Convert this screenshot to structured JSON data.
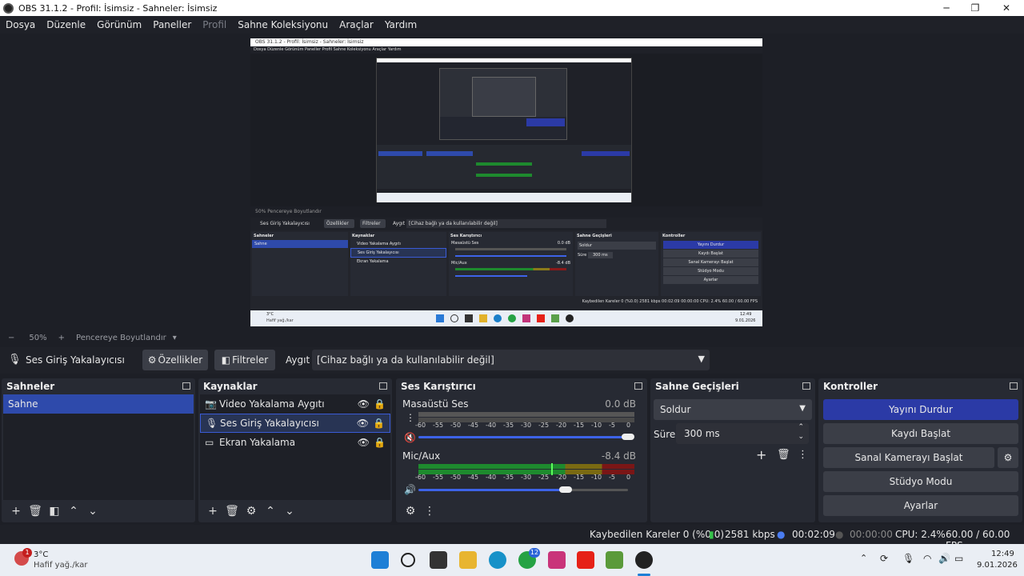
{
  "window": {
    "title": "OBS 31.1.2 - Profil: İsimsiz - Sahneler: İsimsiz",
    "minimize": "─",
    "maximize": "❐",
    "close": "✕"
  },
  "menu": {
    "items": [
      "Dosya",
      "Düzenle",
      "Görünüm",
      "Paneller",
      "Profil",
      "Sahne Koleksiyonu",
      "Araçlar",
      "Yardım"
    ],
    "disabled_index": 4
  },
  "preview_inner": {
    "title": "OBS 31.1.2 - Profil: İsimsiz - Sahneler: İsimsiz",
    "menu": "Dosya   Düzenle   Görünüm   Paneller   Profil   Sahne Koleksiyonu   Araçlar   Yardım",
    "zoom_text": "50%   Pencereye Boyutlandır",
    "source_name": "Ses Giriş Yakalayıcısı",
    "props": "Özellikler",
    "filters": "Filtreler",
    "device_label": "Aygıt",
    "device_value": "[Cihaz bağlı ya da kullanılabilir değil]",
    "scenes_title": "Sahneler",
    "scene": "Sahne",
    "sources_title": "Kaynaklar",
    "sources": [
      "Video Yakalama Aygıtı",
      "Ses Giriş Yakalayıcısı",
      "Ekran Yakalama"
    ],
    "mixer_title": "Ses Karıştırıcı",
    "mixer_ch1": "Masaüstü Ses",
    "mixer_ch1_db": "0.0 dB",
    "mixer_ch2": "Mic/Aux",
    "mixer_ch2_db": "-8.4 dB",
    "trans_title": "Sahne Geçişleri",
    "trans": "Soldur",
    "dur_label": "Süre",
    "dur": "300 ms",
    "ctl_title": "Kontroller",
    "ctl": [
      "Yayını Durdur",
      "Kaydı Başlat",
      "Sanal Kamerayı Başlat",
      "Stüdyo Modu",
      "Ayarlar"
    ],
    "status": "Kaybedilen Kareler 0 (%0.0)   2581 kbps   00:02:09   00:00:00   CPU: 2.4%   60.00 / 60.00 FPS",
    "weather": "3°C",
    "weather_desc": "Hafif yağ./kar",
    "time": "12:49",
    "date": "9.01.2026"
  },
  "zoom": {
    "minus": "−",
    "value": "50%",
    "plus": "+",
    "fit": "Pencereye Boyutlandır"
  },
  "source_toolbar": {
    "source_name": "Ses Giriş Yakalayıcısı",
    "properties": "Özellikler",
    "filters": "Filtreler",
    "device_label": "Aygıt",
    "device_value": "[Cihaz bağlı ya da kullanılabilir değil]"
  },
  "scenes": {
    "title": "Sahneler",
    "items": [
      "Sahne"
    ]
  },
  "sources": {
    "title": "Kaynaklar",
    "items": [
      "Video Yakalama Aygıtı",
      "Ses Giriş Yakalayıcısı",
      "Ekran Yakalama"
    ],
    "selected_index": 1
  },
  "mixer": {
    "title": "Ses Karıştırıcı",
    "scale": [
      "-60",
      "-55",
      "-50",
      "-45",
      "-40",
      "-35",
      "-30",
      "-25",
      "-20",
      "-15",
      "-10",
      "-5",
      "0"
    ],
    "channels": [
      {
        "name": "Masaüstü Ses",
        "db": "0.0 dB",
        "muted": true,
        "level": 0.0,
        "volume": 1.0
      },
      {
        "name": "Mic/Aux",
        "db": "-8.4 dB",
        "muted": false,
        "level": 0.62,
        "volume": 0.68
      }
    ]
  },
  "transitions": {
    "title": "Sahne Geçişleri",
    "type": "Soldur",
    "duration_label": "Süre",
    "duration": "300 ms"
  },
  "controls": {
    "title": "Kontroller",
    "stop_stream": "Yayını Durdur",
    "start_record": "Kaydı Başlat",
    "start_virtualcam": "Sanal Kamerayı Başlat",
    "studio_mode": "Stüdyo Modu",
    "settings": "Ayarlar"
  },
  "status": {
    "dropped": "Kaybedilen Kareler 0 (%0.0)",
    "bitrate": "2581 kbps",
    "stream_time": "00:02:09",
    "record_time": "00:00:00",
    "cpu": "CPU: 2.4%",
    "fps": "60.00 / 60.00 FPS"
  },
  "taskbar": {
    "weather_temp": "3°C",
    "weather_desc": "Hafif yağ./kar",
    "weather_badge": "1",
    "whatsapp_badge": "12",
    "time": "12:49",
    "date": "9.01.2026"
  },
  "colors": {
    "accent": "#2e4aab",
    "stream_btn": "#2b3aa6",
    "meter_green": "#1e8a2e",
    "meter_yellow": "#8a7a1a",
    "meter_red": "#8a1a1a"
  }
}
